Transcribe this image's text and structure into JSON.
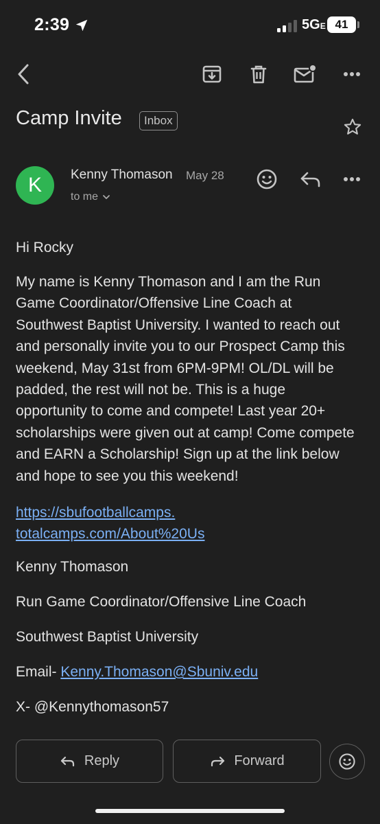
{
  "status_bar": {
    "time": "2:39",
    "network": "5G",
    "network_sub": "E",
    "battery": "41"
  },
  "toolbar": {
    "icons": [
      "back-arrow-icon",
      "archive-icon",
      "trash-icon",
      "mark-unread-icon",
      "more-vert-icon"
    ]
  },
  "email": {
    "subject": "Camp Invite",
    "label": "Inbox",
    "sender": {
      "initial": "K",
      "name": "Kenny Thomason",
      "date": "May 28",
      "recipient": "to me",
      "avatar_color": "#2fb553"
    },
    "greeting": "Hi Rocky",
    "body": "My name is Kenny Thomason and I am the Run Game Coordinator/Offensive Line Coach at Southwest Baptist University. I wanted to reach out and personally invite you to our Prospect Camp this weekend, May 31st from 6PM-9PM! OL/DL will be padded, the rest will not be. This is a huge opportunity to come and compete! Last year 20+ scholarships were given out at camp! Come compete and EARN a Scholarship! Sign up at the link below and hope to see you this weekend!",
    "link_line1": "https://sbufootballcamps.",
    "link_line2": "totalcamps.com/About%20Us",
    "signature": {
      "name": "Kenny Thomason",
      "title": "Run Game Coordinator/Offensive Line Coach",
      "organization": "Southwest Baptist University",
      "email_label": "Email- ",
      "email": "Kenny.Thomason@Sbuniv.edu",
      "social": "X- @Kennythomason57"
    }
  },
  "actions": {
    "reply_label": "Reply",
    "forward_label": "Forward"
  },
  "colors": {
    "background": "#1f1f1f",
    "link": "#7bb0f5",
    "avatar": "#2fb553"
  }
}
